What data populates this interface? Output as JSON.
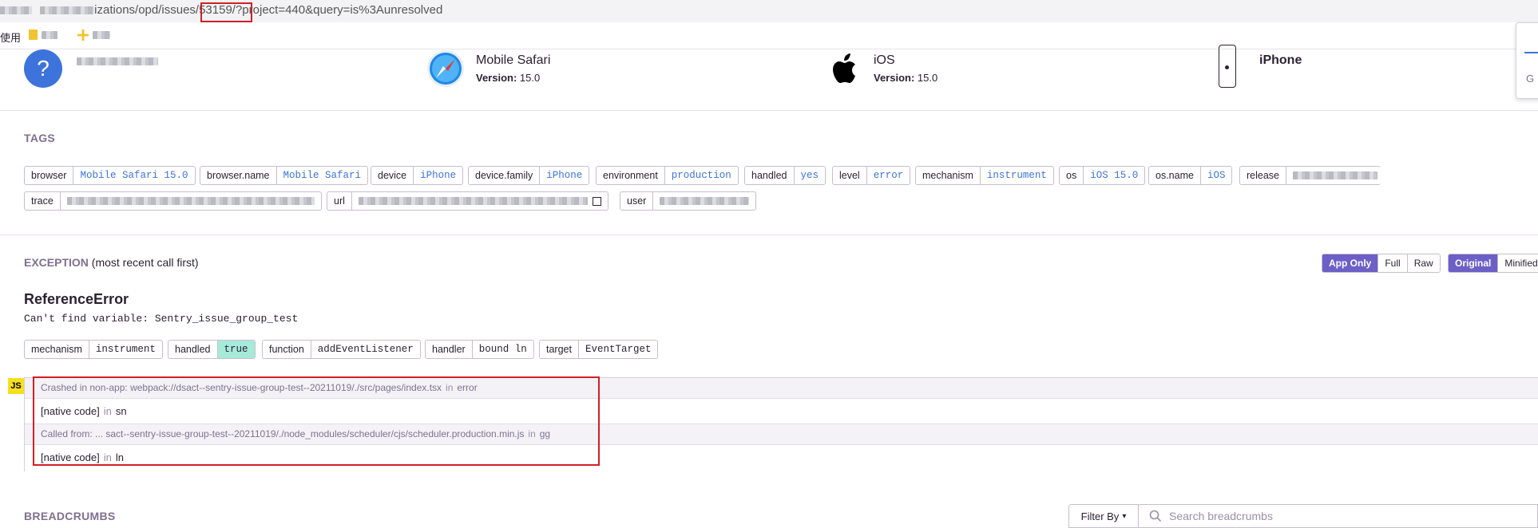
{
  "browser": {
    "url_mid": "izations/opd/issues",
    "url_id": "/53159/",
    "url_rest": "?project=440&query=is%3Aunresolved",
    "bookmarks_label": "使用"
  },
  "context": {
    "browser_name": "Mobile Safari",
    "browser_version_label": "Version:",
    "browser_version": "15.0",
    "os_name": "iOS",
    "os_version_label": "Version:",
    "os_version": "15.0",
    "device_name": "iPhone",
    "user_avatar_glyph": "?",
    "side_letter": "G"
  },
  "tags": {
    "heading": "TAGS",
    "items": [
      {
        "key": "browser",
        "value": "Mobile Safari 15.0"
      },
      {
        "key": "browser.name",
        "value": "Mobile Safari"
      },
      {
        "key": "device",
        "value": "iPhone"
      },
      {
        "key": "device.family",
        "value": "iPhone"
      },
      {
        "key": "environment",
        "value": "production"
      },
      {
        "key": "handled",
        "value": "yes"
      },
      {
        "key": "level",
        "value": "error"
      },
      {
        "key": "mechanism",
        "value": "instrument"
      },
      {
        "key": "os",
        "value": "iOS 15.0"
      },
      {
        "key": "os.name",
        "value": "iOS"
      },
      {
        "key": "release",
        "value": ""
      },
      {
        "key": "trace",
        "value": ""
      },
      {
        "key": "url",
        "value": ""
      },
      {
        "key": "user",
        "value": ""
      }
    ]
  },
  "exception": {
    "heading": "EXCEPTION",
    "heading_note": "(most recent call first)",
    "toggle_app_only": "App Only",
    "toggle_full": "Full",
    "toggle_raw": "Raw",
    "toggle_original": "Original",
    "toggle_minified": "Minified",
    "error_type": "ReferenceError",
    "error_message": "Can't find variable: Sentry_issue_group_test",
    "mechanism_pills": [
      {
        "key": "mechanism",
        "value": "instrument"
      },
      {
        "key": "handled",
        "value": "true"
      },
      {
        "key": "function",
        "value": "addEventListener"
      },
      {
        "key": "handler",
        "value": "bound ln"
      },
      {
        "key": "target",
        "value": "EventTarget"
      }
    ],
    "platform_badge": "JS",
    "frames": [
      {
        "path": "Crashed in non-app: webpack://dsact--sentry-issue-group-test--20211019/./src/pages/index.tsx",
        "in": "in",
        "func": "error"
      },
      {
        "path": "[native code]",
        "in": "in",
        "func": "sn"
      },
      {
        "path": "Called from: ... sact--sentry-issue-group-test--20211019/./node_modules/scheduler/cjs/scheduler.production.min.js",
        "in": "in",
        "func": "gg"
      },
      {
        "path": "[native code]",
        "in": "in",
        "func": "ln"
      }
    ]
  },
  "breadcrumbs": {
    "heading": "BREADCRUMBS",
    "filter_label": "Filter By",
    "search_placeholder": "Search breadcrumbs"
  },
  "colors": {
    "accent": "#6c5fc7",
    "link": "#3d74db",
    "highlight_red": "#d21f26",
    "handled_true_bg": "#a6ead9"
  }
}
